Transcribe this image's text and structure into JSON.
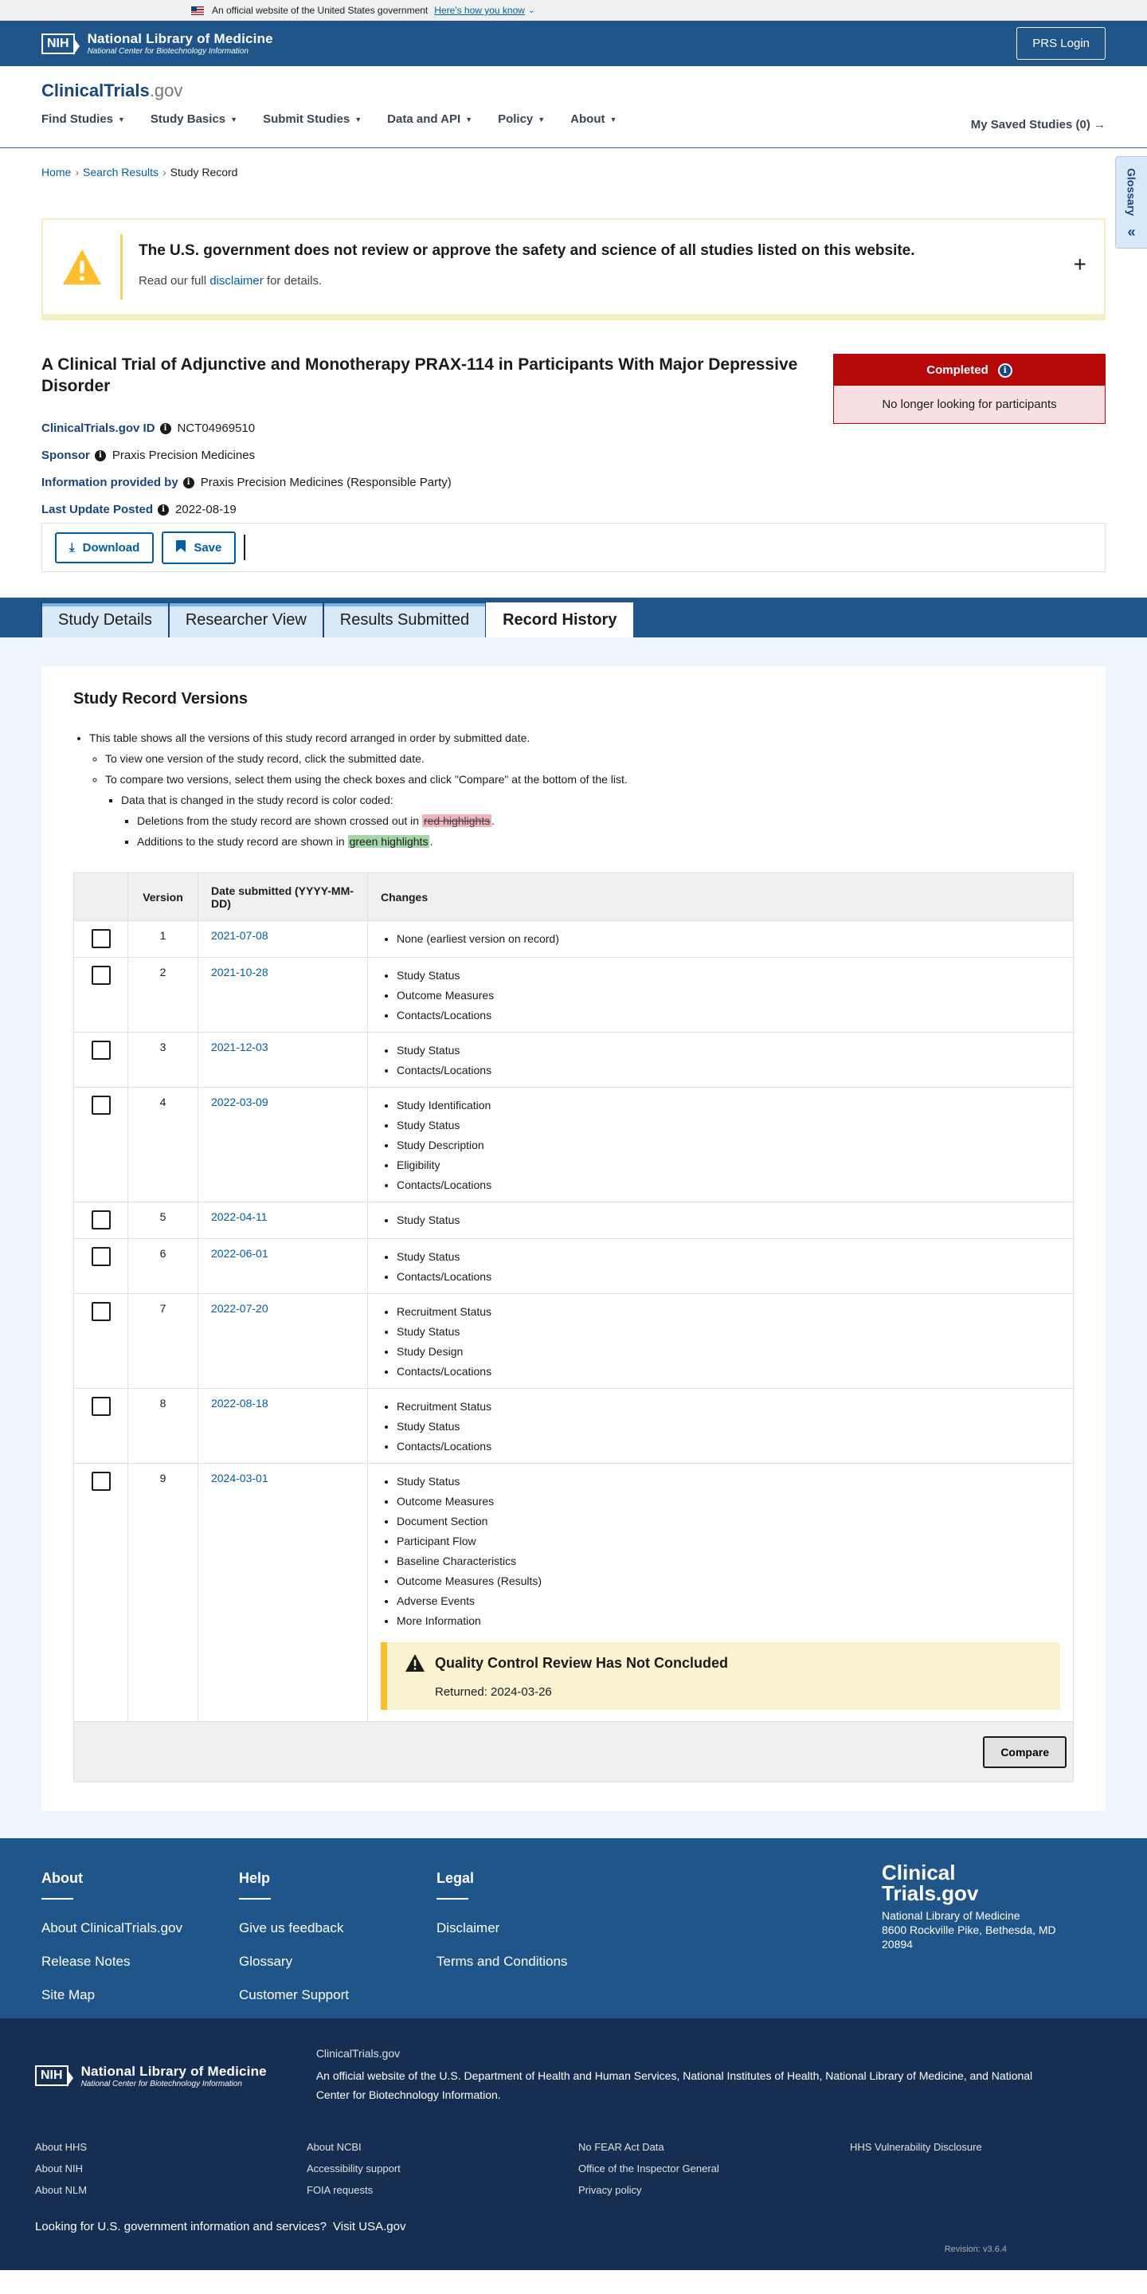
{
  "gov_banner": {
    "text": "An official website of the United States government",
    "link": "Here's how you know"
  },
  "nih": {
    "abbr": "NIH",
    "name": "National Library of Medicine",
    "sub": "National Center for Biotechnology Information",
    "login": "PRS Login"
  },
  "site": {
    "logo_main": "ClinicalTrials",
    "logo_gov": ".gov",
    "nav": [
      "Find Studies",
      "Study Basics",
      "Submit Studies",
      "Data and API",
      "Policy",
      "About"
    ],
    "saved": "My Saved Studies (0)"
  },
  "glossary": "Glossary",
  "breadcrumb": [
    "Home",
    "Search Results",
    "Study Record"
  ],
  "disclaimer": {
    "title": "The U.S. government does not review or approve the safety and science of all studies listed on this website.",
    "pre": "Read our full",
    "link": "disclaimer",
    "post": "for details."
  },
  "study": {
    "title": "A Clinical Trial of Adjunctive and Monotherapy PRAX-114 in Participants With Major Depressive Disorder",
    "id_label": "ClinicalTrials.gov ID",
    "id": "NCT04969510",
    "sponsor_label": "Sponsor",
    "sponsor": "Praxis Precision Medicines",
    "provided_label": "Information provided by",
    "provided": "Praxis Precision Medicines (Responsible Party)",
    "update_label": "Last Update Posted",
    "update": "2022-08-19",
    "status": "Completed",
    "status_sub": "No longer looking for participants"
  },
  "actions": {
    "download": "Download",
    "save": "Save"
  },
  "tabs": [
    "Study Details",
    "Researcher View",
    "Results Submitted",
    "Record History"
  ],
  "history": {
    "title": "Study Record Versions",
    "b1": "This table shows all the versions of this study record arranged in order by submitted date.",
    "b2": "To view one version of the study record, click the submitted date.",
    "b3": "To compare two versions, select them using the check boxes and click \"Compare\" at the bottom of the list.",
    "b4": "Data that is changed in the study record is color coded:",
    "b5_pre": "Deletions from the study record are shown crossed out in",
    "b5_hl": "red highlights",
    "b6_pre": "Additions to the study record are shown in",
    "b6_hl": "green highlights",
    "col_version": "Version",
    "col_date": "Date submitted (YYYY-MM-DD)",
    "col_changes": "Changes",
    "compare": "Compare",
    "qc_title": "Quality Control Review Has Not Concluded",
    "qc_sub": "Returned: 2024-03-26"
  },
  "versions": [
    {
      "v": "1",
      "date": "2021-07-08",
      "changes": [
        "None (earliest version on record)"
      ]
    },
    {
      "v": "2",
      "date": "2021-10-28",
      "changes": [
        "Study Status",
        "Outcome Measures",
        "Contacts/Locations"
      ]
    },
    {
      "v": "3",
      "date": "2021-12-03",
      "changes": [
        "Study Status",
        "Contacts/Locations"
      ]
    },
    {
      "v": "4",
      "date": "2022-03-09",
      "changes": [
        "Study Identification",
        "Study Status",
        "Study Description",
        "Eligibility",
        "Contacts/Locations"
      ]
    },
    {
      "v": "5",
      "date": "2022-04-11",
      "changes": [
        "Study Status"
      ]
    },
    {
      "v": "6",
      "date": "2022-06-01",
      "changes": [
        "Study Status",
        "Contacts/Locations"
      ]
    },
    {
      "v": "7",
      "date": "2022-07-20",
      "changes": [
        "Recruitment Status",
        "Study Status",
        "Study Design",
        "Contacts/Locations"
      ]
    },
    {
      "v": "8",
      "date": "2022-08-18",
      "changes": [
        "Recruitment Status",
        "Study Status",
        "Contacts/Locations"
      ]
    },
    {
      "v": "9",
      "date": "2024-03-01",
      "changes": [
        "Study Status",
        "Outcome Measures",
        "Document Section",
        "Participant Flow",
        "Baseline Characteristics",
        "Outcome Measures (Results)",
        "Adverse Events",
        "More Information"
      ]
    }
  ],
  "footer": {
    "about_h": "About",
    "about": [
      "About ClinicalTrials.gov",
      "Release Notes",
      "Site Map"
    ],
    "help_h": "Help",
    "help": [
      "Give us feedback",
      "Glossary",
      "Customer Support"
    ],
    "legal_h": "Legal",
    "legal": [
      "Disclaimer",
      "Terms and Conditions"
    ],
    "brand": "Clinical Trials.gov",
    "addr1": "National Library of Medicine",
    "addr2": "8600 Rockville Pike, Bethesda, MD",
    "addr3": "20894",
    "ncbi_small": "ClinicalTrials.gov",
    "ncbi_pre": "An official website of the",
    "ncbi_l1": "U.S. Department of Health and Human Services",
    "ncbi_l2": "National Institutes of Health",
    "ncbi_l3": "National Library of Medicine",
    "ncbi_and": "and",
    "ncbi_l4": "National Center for Biotechnology Information",
    "links": [
      "About HHS",
      "About NCBI",
      "No FEAR Act Data",
      "HHS Vulnerability Disclosure",
      "About NIH",
      "Accessibility support",
      "Office of the Inspector General",
      "About NLM",
      "FOIA requests",
      "Privacy policy"
    ],
    "usa_pre": "Looking for U.S. government information and services?",
    "usa_link": "Visit USA.gov",
    "revision": "Revision: v3.6.4"
  }
}
